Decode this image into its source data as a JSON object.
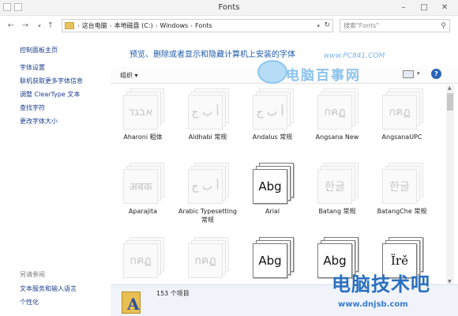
{
  "window": {
    "title": "Fonts",
    "minimize": "–",
    "maximize": "□",
    "close": "✕"
  },
  "address_bar": {
    "back_icon": "arrow-left-icon",
    "forward_icon": "arrow-right-icon",
    "up_icon": "arrow-up-icon",
    "crumbs": [
      "这台电脑",
      "本地磁盘 (C:)",
      "Windows",
      "Fonts"
    ],
    "search_placeholder": "搜索\"Fonts\""
  },
  "left_pane": {
    "links": [
      "控制面板主页",
      "字体设置",
      "联机获取更多字体信息",
      "调整 ClearType 文本",
      "查找字符",
      "更改字体大小"
    ],
    "see_also_heading": "另请参阅",
    "see_also_links": [
      "文本服务和输入语言",
      "个性化"
    ]
  },
  "main": {
    "subtitle": "预览、删除或者显示和隐藏计算机上安装的字体",
    "toolbar": {
      "organize_label": "组织 ▾",
      "help_label": "?"
    }
  },
  "fonts": [
    {
      "name": "Aharoni 粗体",
      "preview": "אבגד",
      "style": "light"
    },
    {
      "name": "Aldhabi 常规",
      "preview": "أ ب ج",
      "style": "light"
    },
    {
      "name": "Andalus 常规",
      "preview": "أ ب ج",
      "style": "light"
    },
    {
      "name": "Angsana New",
      "preview": "กคฏ",
      "style": "light"
    },
    {
      "name": "AngsanaUPC",
      "preview": "กคฏ",
      "style": "light"
    },
    {
      "name": "Aparajita",
      "preview": "अबक",
      "style": "light"
    },
    {
      "name": "Arabic Typesetting 常规",
      "preview": "أ ب ج",
      "style": "light"
    },
    {
      "name": "Arial",
      "preview": "Abg",
      "style": "dark"
    },
    {
      "name": "Batang 常规",
      "preview": "한글",
      "style": "light"
    },
    {
      "name": "BatangChe 常规",
      "preview": "한글",
      "style": "light"
    },
    {
      "name": "",
      "preview": "กคฏ",
      "style": "light"
    },
    {
      "name": "",
      "preview": "กคฏ",
      "style": "light"
    },
    {
      "name": "",
      "preview": "Abg",
      "style": "dark"
    },
    {
      "name": "",
      "preview": "Abg",
      "style": "dark"
    },
    {
      "name": "",
      "preview": "Ïrě",
      "style": "dark-serif"
    }
  ],
  "details": {
    "count": "153 个项目"
  },
  "watermarks": {
    "top_url": "www.PC841.COM",
    "top_text": "电脑百事网",
    "bottom_text": "电脑技术吧",
    "bottom_url": "www.dnjsb.com"
  }
}
